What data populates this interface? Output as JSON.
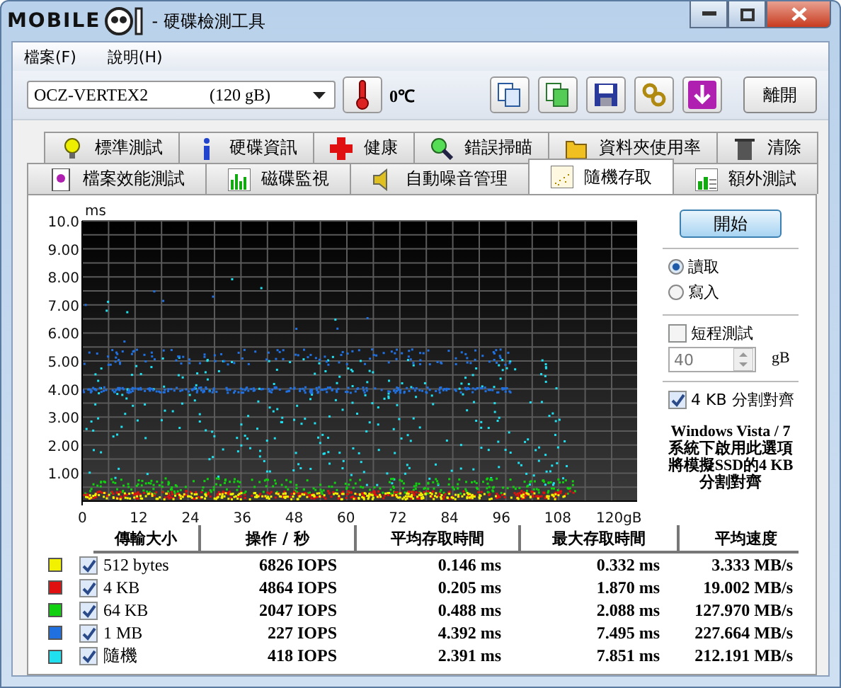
{
  "window": {
    "logo": "MOBILE",
    "title": "- 硬碟檢測工具"
  },
  "menu": [
    {
      "label": "檔案(F)"
    },
    {
      "label": "說明(H)"
    }
  ],
  "drive": {
    "name": "OCZ-VERTEX2",
    "size": "(120 gB)"
  },
  "temperature": "0℃",
  "exit_button": "離開",
  "tabs_top": [
    {
      "label": "標準測試",
      "selected": false
    },
    {
      "label": "硬碟資訊",
      "selected": false
    },
    {
      "label": "健康",
      "selected": false
    },
    {
      "label": "錯誤掃瞄",
      "selected": false
    },
    {
      "label": "資料夾使用率",
      "selected": false
    },
    {
      "label": "清除",
      "selected": false
    }
  ],
  "tabs_bottom": [
    {
      "label": "檔案效能測試",
      "selected": false
    },
    {
      "label": "磁碟監視",
      "selected": false
    },
    {
      "label": "自動噪音管理",
      "selected": false
    },
    {
      "label": "隨機存取",
      "selected": true
    },
    {
      "label": "額外測試",
      "selected": false
    }
  ],
  "chart": {
    "y_unit": "ms",
    "y_ticks": [
      "10.0",
      "9.00",
      "8.00",
      "7.00",
      "6.00",
      "5.00",
      "4.00",
      "3.00",
      "2.00",
      "1.00"
    ],
    "x_ticks": [
      "0",
      "12",
      "24",
      "36",
      "48",
      "60",
      "72",
      "84",
      "96",
      "108",
      "120gB"
    ]
  },
  "controls": {
    "start_button": "開始",
    "modes": [
      {
        "label": "讀取",
        "selected": true
      },
      {
        "label": "寫入",
        "selected": false
      }
    ],
    "short_test": {
      "label": "短程測試",
      "checked": false
    },
    "size_field": {
      "value": "40",
      "unit": "gB"
    },
    "align": {
      "label": "4 KB 分割對齊",
      "checked": true
    },
    "note_lines": [
      "Windows Vista / 7",
      "系統下啟用此選項",
      "將模擬SSD的4 KB",
      "分割對齊"
    ]
  },
  "table": {
    "columns": [
      "傳輸大小",
      "操作 / 秒",
      "平均存取時間",
      "最大存取時間",
      "平均速度"
    ],
    "rows": [
      {
        "color": "#f2f200",
        "checked": true,
        "size": "512 bytes",
        "ops": "6826 IOPS",
        "avg": "0.146 ms",
        "max": "0.332 ms",
        "speed": "3.333 MB/s"
      },
      {
        "color": "#e01010",
        "checked": true,
        "size": "4 KB",
        "ops": "4864 IOPS",
        "avg": "0.205 ms",
        "max": "1.870 ms",
        "speed": "19.002 MB/s"
      },
      {
        "color": "#10d010",
        "checked": true,
        "size": "64 KB",
        "ops": "2047 IOPS",
        "avg": "0.488 ms",
        "max": "2.088 ms",
        "speed": "127.970 MB/s"
      },
      {
        "color": "#2070e0",
        "checked": true,
        "size": "1 MB",
        "ops": "227 IOPS",
        "avg": "4.392 ms",
        "max": "7.495 ms",
        "speed": "227.664 MB/s"
      },
      {
        "color": "#20e0f0",
        "checked": true,
        "size": "隨機",
        "ops": "418 IOPS",
        "avg": "2.391 ms",
        "max": "7.851 ms",
        "speed": "212.191 MB/s"
      }
    ]
  }
}
